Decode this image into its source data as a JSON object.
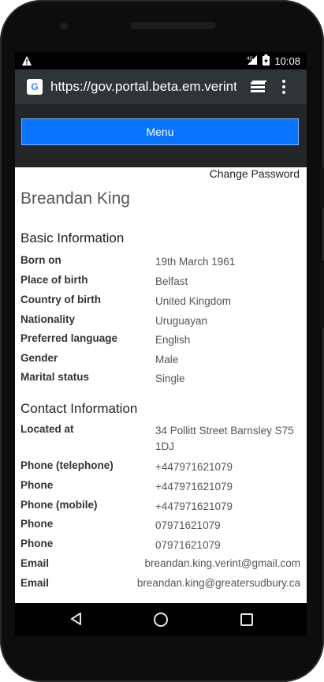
{
  "status_bar": {
    "time": "10:08",
    "network": "4G"
  },
  "browser": {
    "url": "https://gov.portal.beta.em.verintcl",
    "favicon_letter": "G"
  },
  "menu_button": "Menu",
  "change_password": "Change Password",
  "profile_name": "Breandan King",
  "basic_info": {
    "heading": "Basic Information",
    "rows": [
      {
        "label": "Born on",
        "value": "19th March 1961"
      },
      {
        "label": "Place of birth",
        "value": "Belfast"
      },
      {
        "label": "Country of birth",
        "value": "United Kingdom"
      },
      {
        "label": "Nationality",
        "value": "Uruguayan"
      },
      {
        "label": "Preferred language",
        "value": "English"
      },
      {
        "label": "Gender",
        "value": "Male"
      },
      {
        "label": "Marital status",
        "value": "Single"
      }
    ]
  },
  "contact_info": {
    "heading": "Contact Information",
    "rows": [
      {
        "label": "Located at",
        "value": "34 Pollitt Street Barnsley S75 1DJ"
      },
      {
        "label": "Phone (telephone)",
        "value": "+447971621079"
      },
      {
        "label": "Phone",
        "value": "+447971621079"
      },
      {
        "label": "Phone (mobile)",
        "value": "+447971621079"
      },
      {
        "label": "Phone",
        "value": "07971621079"
      },
      {
        "label": "Phone",
        "value": "07971621079"
      },
      {
        "label": "Email",
        "value": "breandan.king.verint@gmail.com"
      },
      {
        "label": "Email",
        "value": "breandan.king@greatersudbury.ca"
      }
    ]
  },
  "colors": {
    "menu_button": "#0a74ff",
    "url_bar": "#2f3437",
    "menu_band": "#222629"
  }
}
